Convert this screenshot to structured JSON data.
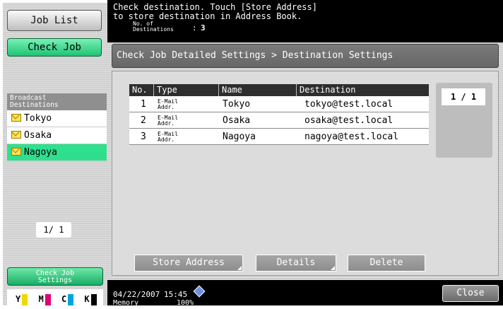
{
  "sidebar": {
    "job_list_label": "Job List",
    "check_job_label": "Check Job",
    "broadcast_header_line1": "Broadcast",
    "broadcast_header_line2": "Destinations",
    "destinations": [
      {
        "name": "Tokyo",
        "selected": false
      },
      {
        "name": "Osaka",
        "selected": false
      },
      {
        "name": "Nagoya",
        "selected": true
      }
    ],
    "page_counter": "1/ 1",
    "check_job_settings_line1": "Check Job",
    "check_job_settings_line2": "Settings",
    "toner": [
      {
        "label": "Y",
        "color": "#f1d800"
      },
      {
        "label": "M",
        "color": "#e0007a"
      },
      {
        "label": "C",
        "color": "#00a5e0"
      },
      {
        "label": "K",
        "color": "#000000"
      }
    ]
  },
  "message": {
    "line1": "Check destination. Touch [Store Address]",
    "line2": "to store destination in Address Book.",
    "dest_count_label_line1": "No. of",
    "dest_count_label_line2": "Destinations",
    "dest_count_colon": ":",
    "dest_count_value": "3"
  },
  "breadcrumb": "Check Job Detailed Settings > Destination Settings",
  "table": {
    "headers": {
      "no": "No.",
      "type": "Type",
      "name": "Name",
      "destination": "Destination"
    },
    "rows": [
      {
        "no": "1",
        "type_line1": "E-Mail",
        "type_line2": "Addr.",
        "name": "Tokyo",
        "destination": "tokyo@test.local"
      },
      {
        "no": "2",
        "type_line1": "E-Mail",
        "type_line2": "Addr.",
        "name": "Osaka",
        "destination": "osaka@test.local"
      },
      {
        "no": "3",
        "type_line1": "E-Mail",
        "type_line2": "Addr.",
        "name": "Nagoya",
        "destination": "nagoya@test.local"
      }
    ]
  },
  "table_page_counter": "1 / 1",
  "actions": {
    "store_address": "Store Address",
    "details": "Details",
    "delete": "Delete"
  },
  "status_bar": {
    "date": "04/22/2007",
    "time": "15:45",
    "memory_label": "Memory",
    "memory_value": "100%",
    "close_label": "Close"
  },
  "colors": {
    "accent_green": "#2ee08e",
    "title_bar": "#000000"
  }
}
